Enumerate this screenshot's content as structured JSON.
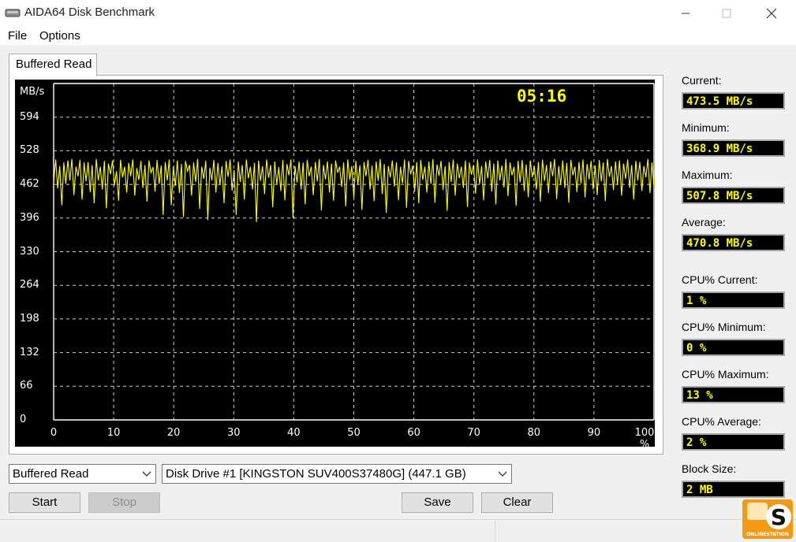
{
  "window": {
    "title": "AIDA64 Disk Benchmark"
  },
  "menu": [
    "File",
    "Options"
  ],
  "tab": {
    "label": "Buffered Read"
  },
  "chart": {
    "timer": "05:16"
  },
  "chart_data": {
    "type": "line",
    "ylabel": "MB/s",
    "ytick_labels": [
      "594",
      "528",
      "462",
      "396",
      "330",
      "264",
      "198",
      "132",
      "66",
      "0"
    ],
    "xtick_labels": [
      "0",
      "10",
      "20",
      "30",
      "40",
      "50",
      "60",
      "70",
      "80",
      "90",
      "100 %"
    ],
    "xlim": [
      0,
      100
    ],
    "ylim": [
      0,
      660
    ],
    "line_color": "#ffff00",
    "series": [
      {
        "values": [
          466,
          511,
          454,
          498,
          421,
          505,
          463,
          509,
          470,
          512,
          441,
          497,
          478,
          510,
          432,
          505,
          468,
          506,
          447,
          500,
          425,
          512,
          470,
          497,
          452,
          508,
          415,
          503,
          482,
          509,
          460,
          488,
          430,
          510,
          476,
          497,
          446,
          504,
          478,
          511,
          440,
          494,
          471,
          508,
          455,
          500,
          428,
          509,
          485,
          496,
          448,
          510,
          463,
          499,
          402,
          506,
          470,
          511,
          421,
          497,
          459,
          509,
          445,
          502,
          398,
          508,
          488,
          500,
          440,
          505,
          467,
          512,
          414,
          497,
          473,
          508,
          392,
          495,
          470,
          510,
          446,
          504,
          461,
          498,
          425,
          508,
          477,
          511,
          450,
          490,
          402,
          507,
          467,
          500,
          432,
          511,
          474,
          497,
          452,
          504,
          388,
          509,
          469,
          498,
          443,
          511,
          475,
          500,
          417,
          507,
          462,
          496,
          449,
          510,
          431,
          502,
          480,
          511,
          396,
          498,
          466,
          507,
          452,
          505,
          423,
          510,
          478,
          497,
          441,
          506,
          468,
          512,
          411,
          500,
          472,
          507,
          446,
          503,
          430,
          509,
          485,
          497,
          457,
          505,
          419,
          511,
          471,
          498,
          437,
          508,
          462,
          500,
          412,
          506,
          478,
          510,
          452,
          499,
          429,
          507,
          469,
          512,
          443,
          502,
          406,
          498,
          476,
          509,
          458,
          505,
          431,
          497,
          464,
          511,
          416,
          508,
          482,
          499,
          448,
          506,
          425,
          510,
          471,
          497,
          446,
          507,
          463,
          512,
          426,
          501,
          479,
          508,
          451,
          498,
          410,
          506,
          467,
          511,
          440,
          503,
          474,
          497,
          455,
          509,
          418,
          505,
          481,
          500,
          444,
          511,
          463,
          498,
          431,
          507,
          474,
          510,
          448,
          503,
          423,
          509,
          470,
          499,
          456,
          512,
          439,
          505,
          480,
          497,
          420,
          508,
          466,
          510,
          449,
          501,
          437,
          509,
          476,
          498,
          452,
          506,
          428,
          511,
          469,
          500,
          445,
          507,
          478,
          512,
          433,
          498,
          461,
          509,
          455,
          504,
          426,
          510,
          480,
          497,
          447,
          506,
          464,
          511,
          436,
          502,
          472,
          508,
          452,
          499,
          441,
          510,
          468,
          505,
          429,
          512,
          477,
          498,
          451,
          507,
          462,
          509,
          440,
          503,
          473,
          511,
          455,
          500,
          432,
          508,
          470,
          506,
          449,
          498,
          476,
          512,
          445,
          505,
          457
        ]
      }
    ]
  },
  "stats": [
    {
      "label": "Current:",
      "value": "473.5 MB/s"
    },
    {
      "label": "Minimum:",
      "value": "368.9 MB/s"
    },
    {
      "label": "Maximum:",
      "value": "507.8 MB/s"
    },
    {
      "label": "Average:",
      "value": "470.8 MB/s"
    },
    {
      "label": "CPU% Current:",
      "value": "1 %"
    },
    {
      "label": "CPU% Minimum:",
      "value": "0 %"
    },
    {
      "label": "CPU% Maximum:",
      "value": "13 %"
    },
    {
      "label": "CPU% Average:",
      "value": "2 %"
    },
    {
      "label": "Block Size:",
      "value": "2 MB"
    }
  ],
  "controls": {
    "test_select": "Buffered Read",
    "drive_select": "Disk Drive #1  [KINGSTON SUV400S37480G]  (447.1 GB)",
    "start": "Start",
    "stop": "Stop",
    "save": "Save",
    "clear": "Clear"
  },
  "logo": {
    "letter": "S",
    "text": "ONLINESTATION"
  }
}
